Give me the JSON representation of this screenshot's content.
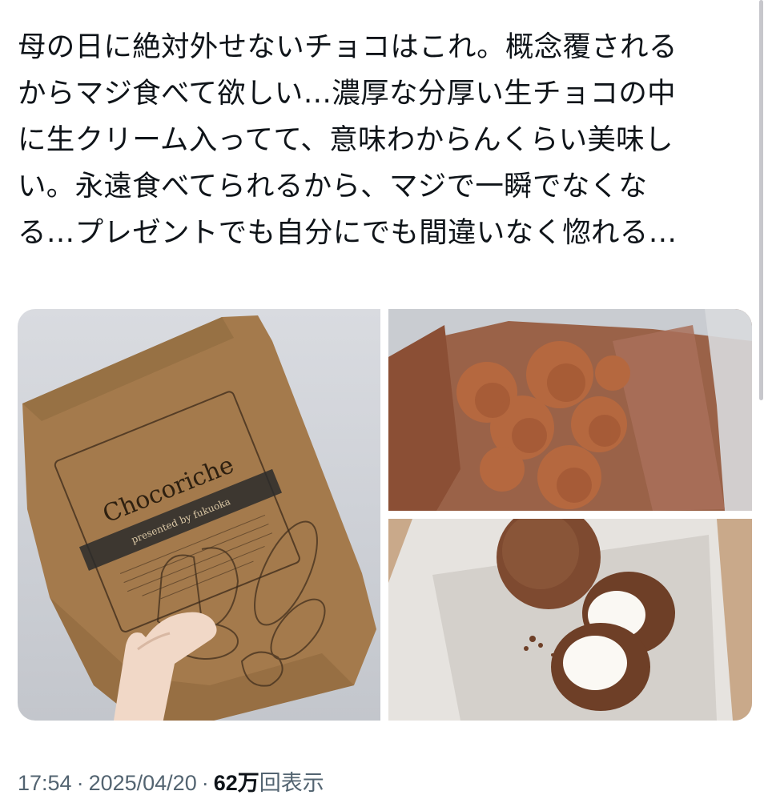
{
  "tweet": {
    "text_lines": [
      "母の日に絶対外せないチョコはこれ。概念覆される",
      "からマジ食べて欲しい…濃厚な分厚い生チョコの中",
      "に生クリーム入ってて、意味わからんくらい美味し",
      "い。永遠食べてられるから、マジで一瞬でなくな",
      "る…プレゼントでも自分にでも間違いなく惚れる…"
    ]
  },
  "media": {
    "package_brand": "Chocoriche",
    "package_subtitle": "presented by fukuoka"
  },
  "meta": {
    "time": "17:54",
    "separator": "·",
    "date": "2025/04/20",
    "views_count": "62",
    "views_unit": "万",
    "views_label": "回表示"
  },
  "colors": {
    "text_primary": "#0f1419",
    "text_secondary": "#536471",
    "kraft_bag": "#a47a4c",
    "cocoa": "#8a5238"
  }
}
